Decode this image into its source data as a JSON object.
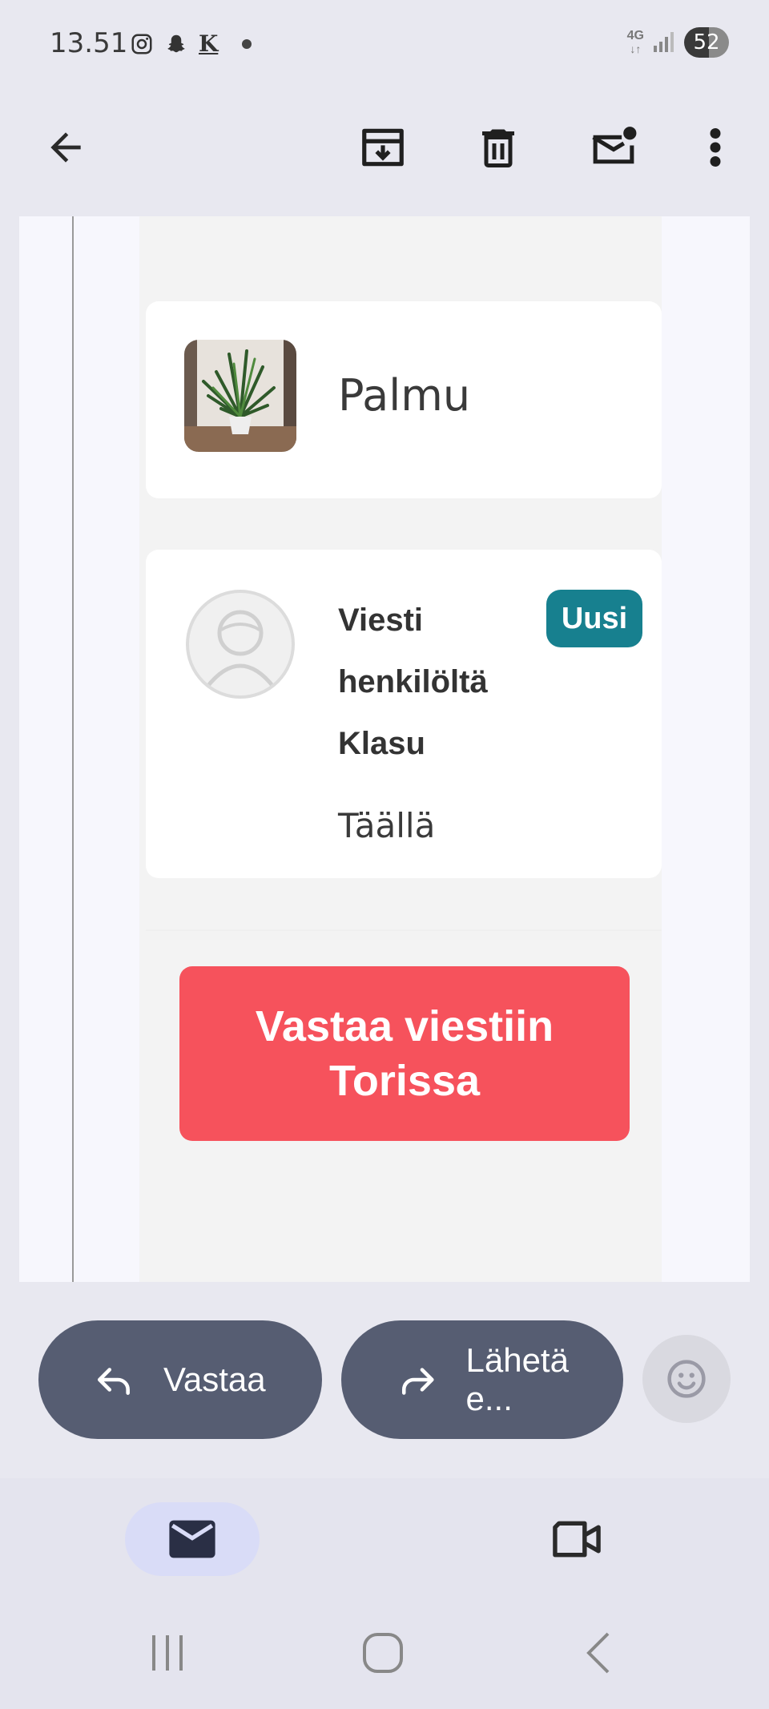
{
  "status_bar": {
    "time": "13.51",
    "network": "4G",
    "battery": "52"
  },
  "app_bar": {
    "icons": [
      "back-arrow-icon",
      "archive-icon",
      "delete-icon",
      "mark-unread-icon",
      "more-vert-icon"
    ]
  },
  "email": {
    "item_title": "Palmu",
    "message_title": "Viesti henkilöltä Klasu",
    "badge": "Uusi",
    "message_text": "Täällä",
    "cta_label": "Vastaa viestiin Torissa"
  },
  "actions": {
    "reply_label": "Vastaa",
    "forward_label": "Lähetä e..."
  },
  "colors": {
    "accent_cta": "#f6525c",
    "badge": "#17808f",
    "pill": "#565d72"
  }
}
